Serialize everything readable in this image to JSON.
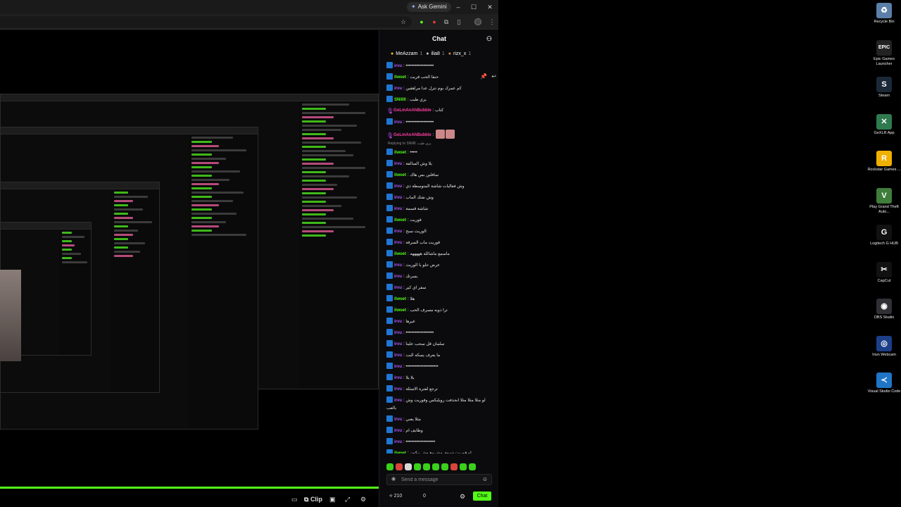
{
  "browser": {
    "ask_gemini": "Ask Gemini",
    "window_buttons": [
      "–",
      "☐",
      "✕"
    ]
  },
  "player": {
    "clip_label": "Clip"
  },
  "chat": {
    "title": "Chat",
    "leaderboard": [
      {
        "name": "MeAzzam",
        "count": "1",
        "rank": "gold"
      },
      {
        "name": "ilia8",
        "count": "1",
        "rank": "silver"
      },
      {
        "name": "rizx_x",
        "count": "1",
        "rank": "bronze"
      }
    ],
    "messages": [
      {
        "user": "irvu",
        "color": "purple",
        "text": "•••••••••••••••••••"
      },
      {
        "user": "ilwoet",
        "color": "green",
        "text": "حنقا الحب قريت",
        "hover": true
      },
      {
        "user": "irvu",
        "color": "purple",
        "text": "كم عمرك يوم تنزل عدا مراهقين"
      },
      {
        "user": "SNillll",
        "color": "green",
        "text": "يزي طيب"
      },
      {
        "user": "GoLmAnAhBubble",
        "color": "pink",
        "text": "كتاب",
        "mic": true
      },
      {
        "user": "irvu",
        "color": "purple",
        "text": "•••••••••••••••••••"
      },
      {
        "user": "GoLmAnAhBubble",
        "color": "pink",
        "text": "",
        "mic": true,
        "emotes": 2
      },
      {
        "reply": "Replying to SNillll: يزي طيب"
      },
      {
        "user": "ilwoet",
        "color": "green",
        "text": "•••••"
      },
      {
        "user": "irvu",
        "color": "purple",
        "text": "يلا وش السالفة"
      },
      {
        "user": "ilwoet",
        "color": "green",
        "text": "سافلين بس هاك"
      },
      {
        "user": "irvu",
        "color": "purple",
        "text": "وش فعاليات شاشة المتوسطة ذي"
      },
      {
        "user": "irvu",
        "color": "purple",
        "text": "وش نفتك الماب"
      },
      {
        "user": "irvu",
        "color": "purple",
        "text": "شاشة قسمة"
      },
      {
        "user": "ilwoet",
        "color": "green",
        "text": "قوريت"
      },
      {
        "user": "irvu",
        "color": "purple",
        "text": "الوريث سبح"
      },
      {
        "user": "irvu",
        "color": "purple",
        "text": "قوريت ماب السرقة"
      },
      {
        "user": "ilwoet",
        "color": "green",
        "text": "ماسمع ماشالله هههههه"
      },
      {
        "user": "irvu",
        "color": "purple",
        "text": "عرض حلو يا الوريث"
      },
      {
        "user": "irvu",
        "color": "purple",
        "text": "يسرتك"
      },
      {
        "user": "irvu",
        "color": "purple",
        "text": "سفر اي كير"
      },
      {
        "user": "ilwoet",
        "color": "green",
        "text": "هلا"
      },
      {
        "user": "ilwoet",
        "color": "green",
        "text": "ترا ذوبه مسرف الحب"
      },
      {
        "user": "irvu",
        "color": "purple",
        "text": "غيرها"
      },
      {
        "user": "irvu",
        "color": "purple",
        "text": "•••••••••••••••••••"
      },
      {
        "user": "irvu",
        "color": "purple",
        "text": "سلمان قل سحب علينا"
      },
      {
        "user": "irvu",
        "color": "purple",
        "text": "ما يعرف يسكه البت"
      },
      {
        "user": "irvu",
        "color": "purple",
        "text": "••••••••••••••••••••••"
      },
      {
        "user": "irvu",
        "color": "purple",
        "text": "يلا يلا"
      },
      {
        "user": "irvu",
        "color": "purple",
        "text": "ترجع لفترة الاسئلة"
      },
      {
        "user": "irvu",
        "color": "purple",
        "text": "لو مثلا مثلا مثلا انحذفت رويليكس وقوريت وش بالعب",
        "multi": true
      },
      {
        "user": "irvu",
        "color": "purple",
        "text": "مثلا يعني"
      },
      {
        "user": "irvu",
        "color": "purple",
        "text": "وظايف ام"
      },
      {
        "user": "irvu",
        "color": "purple",
        "text": "••••••••••••••••••••"
      },
      {
        "user": "ilwoet",
        "color": "green",
        "text": "لو قوريت تسوي مشروع وش بيكون"
      }
    ],
    "send_placeholder": "Send a message",
    "points": "210",
    "zero": "0",
    "chat_button": "Chat"
  },
  "desktop": {
    "icons": [
      {
        "label": "Recycle Bin",
        "glyph": "♻",
        "color": "#5b7fa8"
      },
      {
        "label": "Epic Games Launcher",
        "glyph": "EPIC",
        "color": "#222222"
      },
      {
        "label": "Steam",
        "glyph": "S",
        "color": "#1b2838"
      },
      {
        "label": "GeXLR App",
        "glyph": "✕",
        "color": "#2f7a4f"
      },
      {
        "label": "Rockstar Games ...",
        "glyph": "R",
        "color": "#f0b000"
      },
      {
        "label": "Play Grand Theft Auto...",
        "glyph": "V",
        "color": "#3f7d3a"
      },
      {
        "label": "Logitech G HUB",
        "glyph": "G",
        "color": "#111111"
      },
      {
        "label": "CapCut",
        "glyph": "✂",
        "color": "#111111"
      },
      {
        "label": "OBS Studio",
        "glyph": "◉",
        "color": "#302f35"
      },
      {
        "label": "Iriun Webcam",
        "glyph": "◎",
        "color": "#1c3f8a"
      },
      {
        "label": "Visual Studio Code",
        "glyph": "≺",
        "color": "#1f76c7"
      }
    ]
  }
}
